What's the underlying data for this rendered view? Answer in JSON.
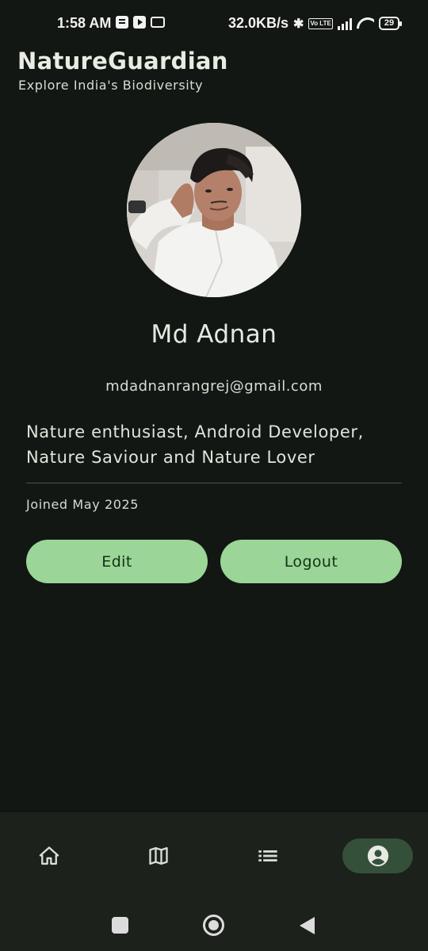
{
  "status_bar": {
    "time": "1:58 AM",
    "network_speed": "32.0KB/s",
    "volte": "Vo LTE",
    "battery": "29"
  },
  "header": {
    "title": "NatureGuardian",
    "subtitle": "Explore India's Biodiversity"
  },
  "profile": {
    "name": "Md Adnan",
    "email": "mdadnanrangrej@gmail.com",
    "bio": "Nature enthusiast, Android Developer, Nature Saviour and Nature Lover",
    "joined": "Joined May 2025"
  },
  "actions": {
    "edit_label": "Edit",
    "logout_label": "Logout"
  },
  "bottom_nav": {
    "items": [
      {
        "icon": "home-icon",
        "selected": false
      },
      {
        "icon": "map-icon",
        "selected": false
      },
      {
        "icon": "list-icon",
        "selected": false
      },
      {
        "icon": "account-circle-icon",
        "selected": true
      }
    ]
  },
  "colors": {
    "background": "#121713",
    "accent_button": "#9bd597",
    "nav_selected": "#35503a",
    "nav_background": "#1c211c"
  }
}
